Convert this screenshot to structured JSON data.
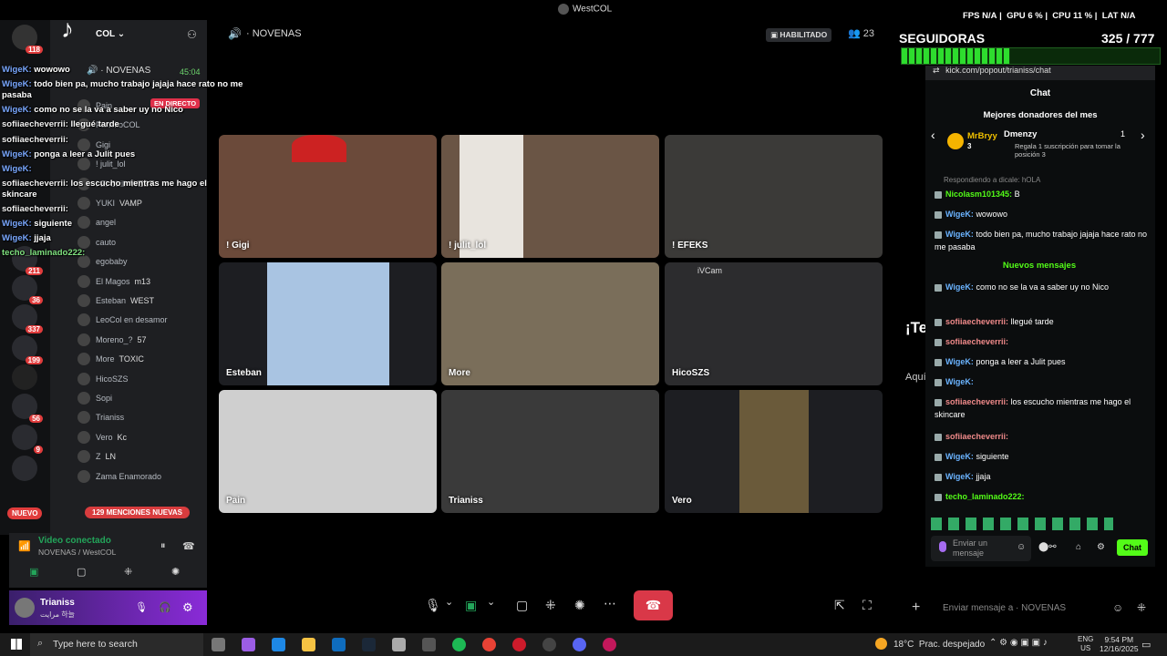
{
  "window": {
    "title": "WestCOL"
  },
  "header": {
    "server_name": "COL",
    "channel_name": "NOVENAS",
    "status_badge": "HABILITADO",
    "participant_count": "23"
  },
  "stats": {
    "fps_label": "FPS",
    "fps_value": "N/A",
    "gpu_label": "GPU",
    "gpu_value": "6 %",
    "cpu_label": "CPU",
    "cpu_value": "11 %",
    "lat_label": "LAT",
    "lat_value": "N/A"
  },
  "followers": {
    "label": "SEGUIDORAS",
    "count": "325 / 777",
    "progress": 0.42
  },
  "channel_list": {
    "voice_channel": "NOVENAS",
    "timer": "45:04",
    "live_badge": "EN DIRECTO",
    "members": [
      "Pain",
      "PancitoCOL",
      "Gigi",
      "! julit_lol",
      "! El Chill",
      "YUKI",
      "angel",
      "cauto",
      "egobaby",
      "El Magos",
      "Esteban",
      "LeoCol en desamor",
      "Moreno_?",
      "More",
      "HicoSZS",
      "Sopi",
      "Trianiss",
      "Vero",
      "Z",
      "Zama Enamorado"
    ],
    "member_tags": [
      "",
      "",
      "",
      "",
      "WEST",
      "VAMP",
      "",
      "",
      "",
      "m13",
      "WEST",
      "",
      "57",
      "TOXIC",
      "",
      "",
      "",
      "Kc",
      "LN",
      ""
    ],
    "mentions_button": "129 MENCIONES NUEVAS",
    "new_badge": "NUEVO"
  },
  "rail_badges": [
    "118",
    "211",
    "36",
    "337",
    "199",
    "56",
    "9"
  ],
  "overlay_chat": [
    {
      "user": "WigeK:",
      "text": "wowowo"
    },
    {
      "user": "WigeK:",
      "text": "todo bien pa, mucho trabajo jajaja hace rato no me"
    },
    {
      "user": "",
      "text": "pasaba"
    },
    {
      "user": "WigeK:",
      "text": "como no se la va a saber uy no Nico"
    },
    {
      "user": "sofiiaecheverrii:",
      "text": "llegué tarde"
    },
    {
      "user": "sofiiaecheverrii:",
      "text": ""
    },
    {
      "user": "WigeK:",
      "text": "ponga a leer a Julit pues"
    },
    {
      "user": "WigeK:",
      "text": ""
    },
    {
      "user": "sofiiaecheverrii:",
      "text": "los escucho mientras me hago el"
    },
    {
      "user": "",
      "text": "skincare"
    },
    {
      "user": "sofiiaecheverrii:",
      "text": ""
    },
    {
      "user": "WigeK:",
      "text": "siguiente"
    },
    {
      "user": "WigeK:",
      "text": "jjaja"
    },
    {
      "user": "techo_laminado222:",
      "text": ""
    }
  ],
  "tiles": [
    {
      "label": "! Gigi"
    },
    {
      "label": "! julit_lol"
    },
    {
      "label": "! EFEKS"
    },
    {
      "label": "Esteban"
    },
    {
      "label": "More"
    },
    {
      "label": "HicoSZS"
    },
    {
      "label": "Pain"
    },
    {
      "label": "Trianiss"
    },
    {
      "label": "Vero"
    }
  ],
  "tile_cam_label": "iVCam",
  "voice_panel": {
    "status": "Video conectado",
    "location": "NOVENAS / WestCOL",
    "user": "Trianiss",
    "user_sub": "مرایت 하늘"
  },
  "kick": {
    "url": "kick.com/popout/trianiss/chat",
    "title": "Chat",
    "donors_title": "Mejores donadores del mes",
    "donor1": "MrBryy",
    "donor1_count": "3",
    "donor2": "Dmenzy",
    "donor2_count": "1",
    "donor2_sub": "Regala 1 suscripción para tomar la posición 3",
    "replying": "Respondiendo a dicale: hOLA",
    "new_messages": "Nuevos mensajes",
    "messages": [
      {
        "user": "Nicolasm101345:",
        "text": "B",
        "cls": "u3"
      },
      {
        "user": "WigeK:",
        "text": "wowowo",
        "cls": "u"
      },
      {
        "user": "WigeK:",
        "text": "todo bien pa, mucho trabajo jajaja hace rato no me pasaba",
        "cls": "u"
      },
      {
        "user": "WigeK:",
        "text": "como no se la va a saber uy no Nico",
        "cls": "u"
      },
      {
        "user": "sofiiaecheverrii:",
        "text": "llegué tarde",
        "cls": "u2"
      },
      {
        "user": "sofiiaecheverrii:",
        "text": "",
        "cls": "u2"
      },
      {
        "user": "WigeK:",
        "text": "ponga a leer a Julit pues",
        "cls": "u"
      },
      {
        "user": "WigeK:",
        "text": "",
        "cls": "u"
      },
      {
        "user": "sofiiaecheverrii:",
        "text": "los escucho mientras me hago el skincare",
        "cls": "u2"
      },
      {
        "user": "sofiiaecheverrii:",
        "text": "",
        "cls": "u2"
      },
      {
        "user": "WigeK:",
        "text": "siguiente",
        "cls": "u"
      },
      {
        "user": "WigeK:",
        "text": "jjaja",
        "cls": "u"
      },
      {
        "user": "techo_laminado222:",
        "text": "",
        "cls": "u3"
      }
    ],
    "input_placeholder": "Enviar un mensaje",
    "send_button": "Chat"
  },
  "side_partial": {
    "t": "¡Te",
    "sub": "Aquí"
  },
  "bottom": {
    "message_placeholder": "Enviar mensaje a",
    "message_channel": "NOVENAS"
  },
  "taskbar": {
    "search_placeholder": "Type here to search",
    "weather": "18°C  Prac. despejado",
    "lang": "ENG",
    "region": "US",
    "time": "9:54 PM",
    "date": "12/16/2025"
  },
  "colors": {
    "kick_green": "#53fc18",
    "end_call": "#d93848",
    "purple": "#5b2bb5"
  }
}
